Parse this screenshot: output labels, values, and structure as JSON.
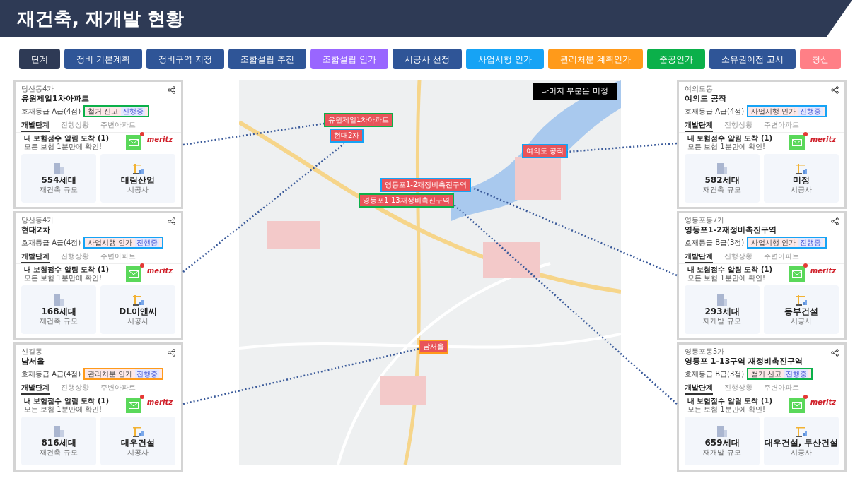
{
  "title": "재건축, 재개발 현황",
  "stages": [
    {
      "label": "단계",
      "color": "#2e3a55"
    },
    {
      "label": "정비 기본계획",
      "color": "#2f5597"
    },
    {
      "label": "정비구역 지정",
      "color": "#2f5597"
    },
    {
      "label": "조합설립 추진",
      "color": "#2f5597"
    },
    {
      "label": "조합설립 인가",
      "color": "#9966ff"
    },
    {
      "label": "시공사 선정",
      "color": "#2f5597"
    },
    {
      "label": "사업시행 인가",
      "color": "#16a3f5"
    },
    {
      "label": "관리처분 계획인가",
      "color": "#ff9a1a"
    },
    {
      "label": "준공인가",
      "color": "#0bb04a"
    },
    {
      "label": "소유권이전 고시",
      "color": "#2f5597"
    },
    {
      "label": "청산",
      "color": "#ff7f86"
    }
  ],
  "map": {
    "note": "나머지 부분은 미정",
    "labels": [
      {
        "text": "유원제일1차아파트",
        "color": "#0bb04a"
      },
      {
        "text": "현대2차",
        "color": "#16a3f5"
      },
      {
        "text": "여의도 공작",
        "color": "#16a3f5"
      },
      {
        "text": "영등포1-2재정비촉진구역",
        "color": "#16a3f5"
      },
      {
        "text": "영등포1-13재정비촉진구역",
        "color": "#0bb04a"
      },
      {
        "text": "남서울",
        "color": "#ff9a1a"
      }
    ]
  },
  "cards": [
    {
      "district": "당산동4가",
      "name": "유원제일1차아파트",
      "grade": "호재등급 A급(4점)",
      "status": "철거 신고",
      "progress": "진행중",
      "color": "#0bb04a",
      "tabs": [
        {
          "label": "개발단계",
          "selected": true
        },
        {
          "label": "진행상황",
          "selected": false
        },
        {
          "label": "주변아파트",
          "selected": false
        }
      ],
      "ad_title": "내 보험점수 알림 도착 (1)",
      "ad_text": "모든 보험 1분만에 확인!",
      "ad_brand": "meritz",
      "households": "554세대",
      "households_label": "재건축 규모",
      "builder": "대림산업",
      "builder_label": "시공사"
    },
    {
      "district": "당산동4가",
      "name": "현대2차",
      "grade": "호재등급 A급(4점)",
      "status": "사업시행 인가",
      "progress": "진행중",
      "color": "#16a3f5",
      "tabs": [
        {
          "label": "개발단계",
          "selected": true
        },
        {
          "label": "진행상황",
          "selected": false
        },
        {
          "label": "주변아파트",
          "selected": false
        }
      ],
      "ad_title": "내 보험점수 알림 도착 (1)",
      "ad_text": "모든 보험 1분만에 확인!",
      "ad_brand": "meritz",
      "households": "168세대",
      "households_label": "재건축 규모",
      "builder": "DL이앤씨",
      "builder_label": "시공사"
    },
    {
      "district": "신길동",
      "name": "남서울",
      "grade": "호재등급 A급(4점)",
      "status": "관리처분 인가",
      "progress": "진행중",
      "color": "#ff9a1a",
      "tabs": [
        {
          "label": "개발단계",
          "selected": true
        },
        {
          "label": "진행상황",
          "selected": false
        },
        {
          "label": "주변아파트",
          "selected": false
        }
      ],
      "ad_title": "내 보험점수 알림 도착 (1)",
      "ad_text": "모든 보험 1분만에 확인!",
      "ad_brand": "meritz",
      "households": "816세대",
      "households_label": "재건축 규모",
      "builder": "대우건설",
      "builder_label": "시공사"
    },
    {
      "district": "여의도동",
      "name": "여의도 공작",
      "grade": "호재등급 A급(4점)",
      "status": "사업시행 인가",
      "progress": "진행중",
      "color": "#16a3f5",
      "tabs": [
        {
          "label": "개발단계",
          "selected": true
        },
        {
          "label": "진행상황",
          "selected": false
        },
        {
          "label": "주변아파트",
          "selected": false
        }
      ],
      "ad_title": "내 보험점수 알림 도착 (1)",
      "ad_text": "모든 보험 1분만에 확인!",
      "ad_brand": "meritz",
      "households": "582세대",
      "households_label": "재건축 규모",
      "builder": "미정",
      "builder_label": "시공사"
    },
    {
      "district": "영등포동7가",
      "name": "영등포1-2재정비촉진구역",
      "grade": "호재등급 B급(3점)",
      "status": "사업시행 인가",
      "progress": "진행중",
      "color": "#16a3f5",
      "tabs": [
        {
          "label": "개발단계",
          "selected": true
        },
        {
          "label": "진행상황",
          "selected": false
        },
        {
          "label": "주변아파트",
          "selected": false
        }
      ],
      "ad_title": "내 보험점수 알림 도착 (1)",
      "ad_text": "모든 보험 1분만에 확인!",
      "ad_brand": "meritz",
      "households": "293세대",
      "households_label": "재개발 규모",
      "builder": "동부건설",
      "builder_label": "시공사"
    },
    {
      "district": "영등포동5가",
      "name": "영등포 1-13구역 재정비촉진구역",
      "grade": "호재등급 B급(3점)",
      "status": "철거 신고",
      "progress": "진행중",
      "color": "#0bb04a",
      "tabs": [
        {
          "label": "개발단계",
          "selected": true
        },
        {
          "label": "진행상황",
          "selected": false
        },
        {
          "label": "주변아파트",
          "selected": false
        }
      ],
      "ad_title": "내 보험점수 알림 도착 (1)",
      "ad_text": "모든 보험 1분만에 확인!",
      "ad_brand": "meritz",
      "households": "659세대",
      "households_label": "재개발 규모",
      "builder": "대우건설, 두산건설",
      "builder_label": "시공사"
    }
  ]
}
